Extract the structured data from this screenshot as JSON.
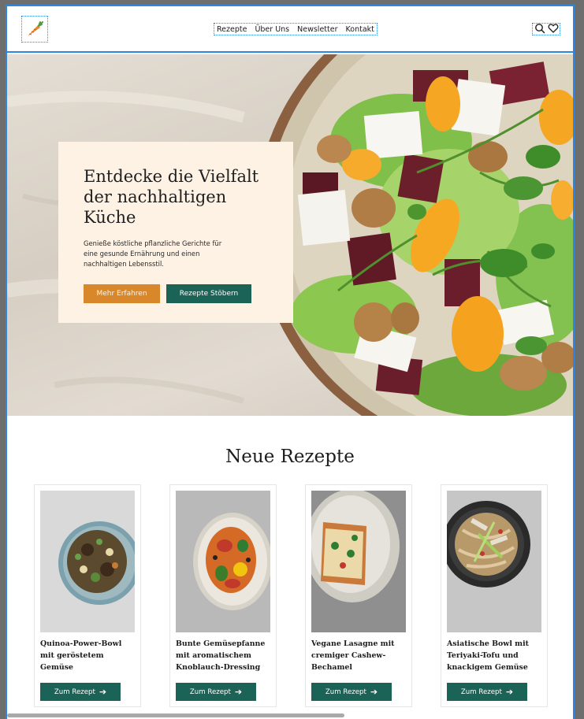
{
  "nav": {
    "items": [
      "Rezepte",
      "Über Uns",
      "Newsletter",
      "Kontakt"
    ]
  },
  "icons": {
    "logo": "carrot-icon",
    "search": "search-icon",
    "favorites": "heart-icon"
  },
  "hero": {
    "title": "Entdecke die Vielfalt der nachhaltigen Küche",
    "text": "Genieße köstliche pflanzliche Gerichte für eine gesunde Ernährung und einen nachhaltigen Lebensstil.",
    "primary_button": "Mehr Erfahren",
    "secondary_button": "Rezepte Stöbern"
  },
  "recipes": {
    "heading": "Neue Rezepte",
    "button_label": "Zum Rezept",
    "button_icon": "arrow-right-icon",
    "items": [
      {
        "title": "Quinoa-Power-Bowl mit geröstetem Gemüse"
      },
      {
        "title": "Bunte Gemüsepfanne mit aromatischem Knoblauch-Dressing"
      },
      {
        "title": "Vegane Lasagne mit cremiger Cashew-Bechamel"
      },
      {
        "title": "Asiatische Bowl mit Teriyaki-Tofu und knackigem Gemüse"
      }
    ]
  },
  "colors": {
    "accent_orange": "#d8882a",
    "accent_teal": "#1b6356",
    "hero_card": "#fdf2e4",
    "selection_outline": "#2f86e0"
  }
}
